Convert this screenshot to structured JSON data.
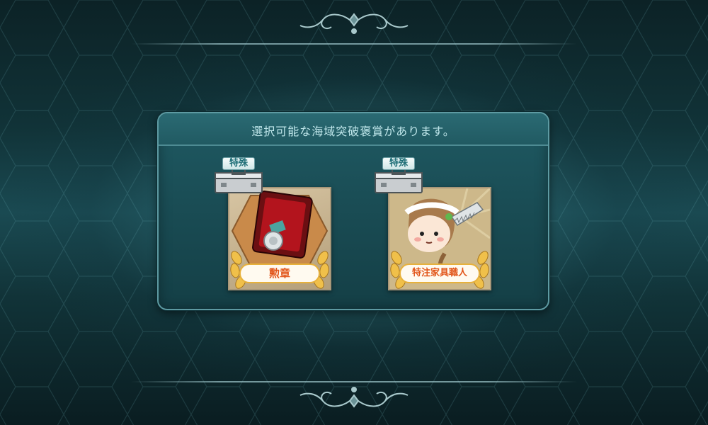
{
  "dialog": {
    "message": "選択可能な海域突破褒賞があります。"
  },
  "rewards": [
    {
      "badge": "特殊",
      "name": "勲章",
      "icon": "medal-case-icon"
    },
    {
      "badge": "特殊",
      "name": "特注家具職人",
      "icon": "furniture-craftsman-icon"
    }
  ],
  "colors": {
    "panel": "#1a4d55",
    "panel_border": "#5d9aa2",
    "message_text": "#bfe6ea",
    "reward_name_text": "#e2561b",
    "laurel_gold": "#e7b13c"
  }
}
